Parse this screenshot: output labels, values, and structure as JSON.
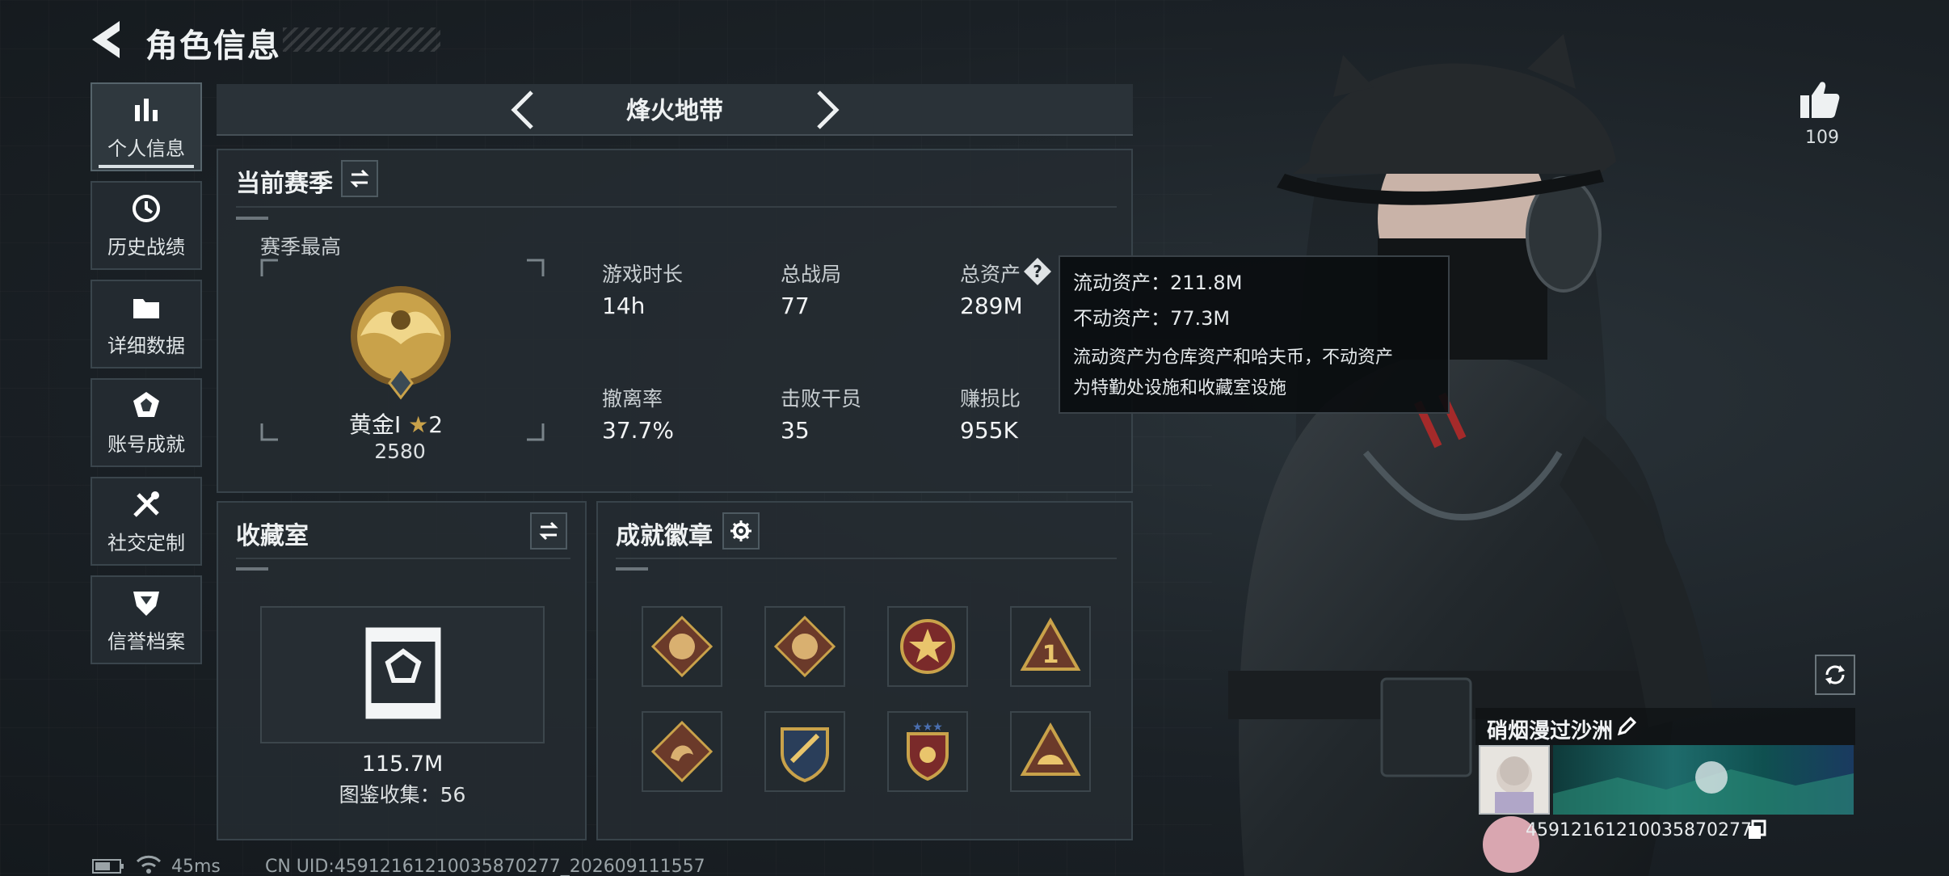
{
  "header": {
    "title": "角色信息"
  },
  "sidebar": {
    "items": [
      {
        "label": "个人信息",
        "icon": "bar-chart-icon",
        "active": true
      },
      {
        "label": "历史战绩",
        "icon": "history-clock-icon"
      },
      {
        "label": "详细数据",
        "icon": "folder-icon"
      },
      {
        "label": "账号成就",
        "icon": "medal-icon"
      },
      {
        "label": "社交定制",
        "icon": "tools-icon"
      },
      {
        "label": "信誉档案",
        "icon": "shield-icon"
      }
    ]
  },
  "mode": {
    "name": "烽火地带"
  },
  "season": {
    "title": "当前赛季",
    "peak_label": "赛季最高",
    "rank_name": "黄金I",
    "rank_stars": "2",
    "rank_score": "2580",
    "stats": [
      {
        "label": "游戏时长",
        "value": "14h"
      },
      {
        "label": "总战局",
        "value": "77"
      },
      {
        "label": "总资产",
        "value": "289M"
      },
      {
        "label": "撤离率",
        "value": "37.7%"
      },
      {
        "label": "击败干员",
        "value": "35"
      },
      {
        "label": "赚损比",
        "value": "955K"
      }
    ]
  },
  "tooltip": {
    "liquid": "流动资产：211.8M",
    "fixed": "不动资产：77.3M",
    "desc_1": "流动资产为仓库资产和哈夫币，不动资产",
    "desc_2": "为特勤处设施和收藏室设施"
  },
  "collection": {
    "title": "收藏室",
    "value": "115.7M",
    "catalog": "图鉴收集：56"
  },
  "badges": {
    "title": "成就徽章",
    "items": [
      "wolf-badge-icon",
      "wolf-badge-icon",
      "star-badge-icon",
      "triangle-one-badge-icon",
      "dragon-badge-icon",
      "shield-badge-icon",
      "stars-shield-badge-icon",
      "triangle-hat-badge-icon"
    ]
  },
  "profile": {
    "likes": "109",
    "name": "硝烟漫过沙洲",
    "uid": "459121612100358702​77"
  },
  "status": {
    "ping": "45ms",
    "uid_line": "CN UID:45912161210035870277_202609111557"
  },
  "colors": {
    "accent": "#e8eef0",
    "panel": "#242b31",
    "gold": "#c9a24a"
  }
}
